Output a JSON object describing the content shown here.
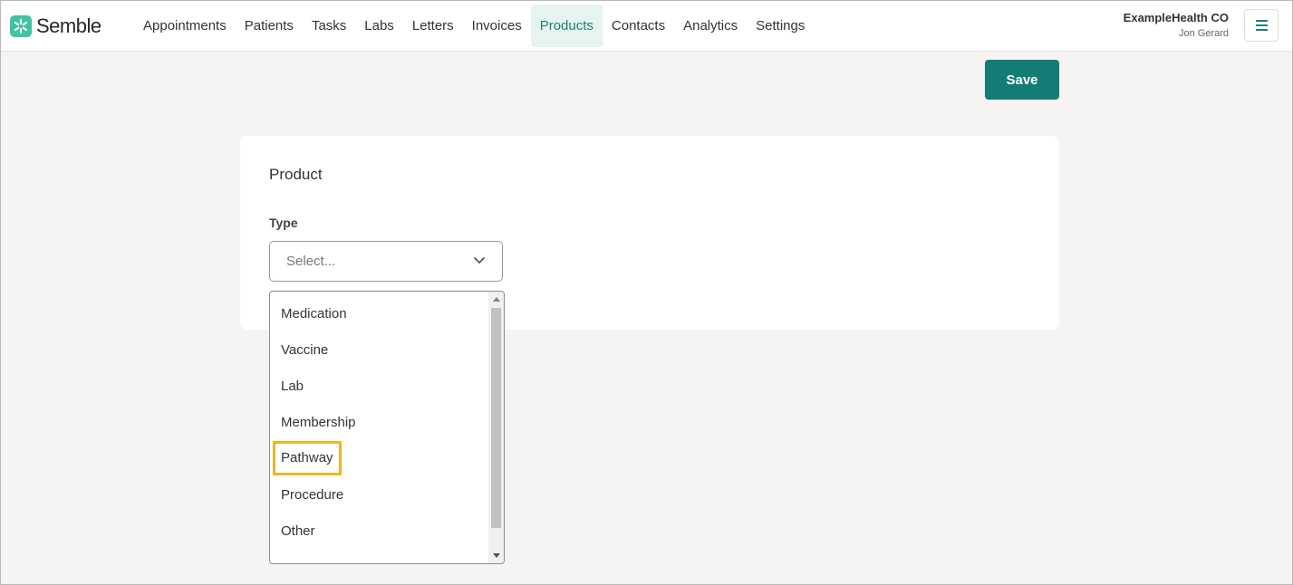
{
  "brand": {
    "name": "Semble",
    "accent": "#137d75",
    "logo_color": "#3ec4a0"
  },
  "nav": {
    "items": [
      {
        "label": "Appointments",
        "active": false
      },
      {
        "label": "Patients",
        "active": false
      },
      {
        "label": "Tasks",
        "active": false
      },
      {
        "label": "Labs",
        "active": false
      },
      {
        "label": "Letters",
        "active": false
      },
      {
        "label": "Invoices",
        "active": false
      },
      {
        "label": "Products",
        "active": true
      },
      {
        "label": "Contacts",
        "active": false
      },
      {
        "label": "Analytics",
        "active": false
      },
      {
        "label": "Settings",
        "active": false
      }
    ]
  },
  "account": {
    "org_name": "ExampleHealth CO",
    "user_name": "Jon Gerard",
    "menu_icon": "hamburger-icon"
  },
  "toolbar": {
    "save_label": "Save"
  },
  "card": {
    "title": "Product",
    "type_label": "Type",
    "type_placeholder": "Select...",
    "chevron_icon": "chevron-down-icon"
  },
  "dropdown": {
    "options": [
      {
        "label": "Medication",
        "highlighted": false
      },
      {
        "label": "Vaccine",
        "highlighted": false
      },
      {
        "label": "Lab",
        "highlighted": false
      },
      {
        "label": "Membership",
        "highlighted": false
      },
      {
        "label": "Pathway",
        "highlighted": true
      },
      {
        "label": "Procedure",
        "highlighted": false
      },
      {
        "label": "Other",
        "highlighted": false
      }
    ],
    "highlight_color": "#f0b429"
  }
}
